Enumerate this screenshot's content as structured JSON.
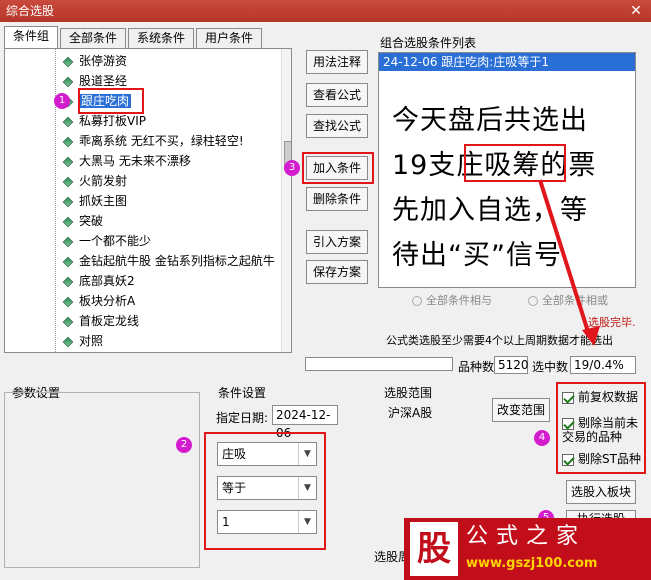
{
  "window": {
    "title": "综合选股"
  },
  "tabs": [
    "条件组",
    "全部条件",
    "系统条件",
    "用户条件"
  ],
  "tree_items": [
    "张停游资",
    "股道圣经",
    "跟庄吃肉",
    "私募打板VIP",
    "乖离系统 无红不买，绿柱轻空!",
    "大黑马 无未来不漂移",
    "火箭发射",
    "抓妖主图",
    "突破",
    "一个都不能少",
    "金钻起航牛股 金钻系列指标之起航牛",
    "底部真妖2",
    "板块分析A",
    "首板定龙线",
    "对照"
  ],
  "buttons": {
    "usage": "用法注释",
    "view_formula": "查看公式",
    "find_formula": "查找公式",
    "add_condition": "加入条件",
    "delete_condition": "删除条件",
    "import_plan": "引入方案",
    "save_plan": "保存方案",
    "change_range": "改变范围",
    "pick_into_board": "选股入板块",
    "execute": "执行选股"
  },
  "condition_list": {
    "label": "组合选股条件列表",
    "rows": [
      "24-12-06 跟庄吃肉:庄吸等于1"
    ],
    "overlay_lines": [
      "今天盘后共选出",
      "19支庄吸筹的票",
      "先加入自选，等",
      "待出“买”信号"
    ]
  },
  "logic": {
    "and": "全部条件相与",
    "or": "全部条件相或"
  },
  "status": {
    "done": "选股完毕.",
    "hint": "公式类选股至少需要4个以上周期数据才能选出",
    "count_label": "品种数",
    "count_value": "5120",
    "selected_label": "选中数",
    "selected_value": "19/0.4%"
  },
  "params": {
    "label": "参数设置"
  },
  "cond_settings": {
    "label": "条件设置",
    "date_label": "指定日期:",
    "date_value": "2024-12-06",
    "select1": "庄吸",
    "select2": "等于",
    "select3": "1"
  },
  "range": {
    "label": "选股范围",
    "value": "沪深A股",
    "bottom_label": "选股周"
  },
  "checks": [
    "前复权数据",
    "剔除当前未交易的品种",
    "剔除ST品种"
  ],
  "markers": [
    "1",
    "2",
    "3",
    "4",
    "5"
  ],
  "watermark": {
    "brand": "股",
    "name": "公式之家",
    "url": "www.gszj100.com"
  },
  "colors": {
    "accent": "#e0161b",
    "select_blue": "#2a6fd6",
    "marker": "#d41ccf"
  }
}
